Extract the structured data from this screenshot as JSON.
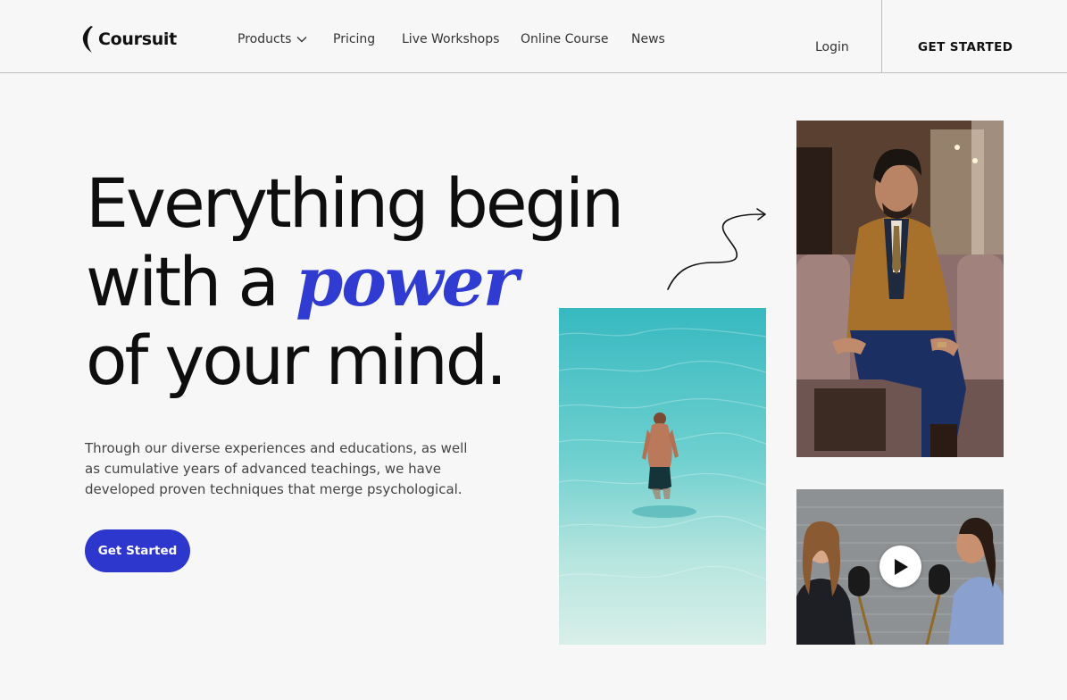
{
  "brand": {
    "name": "Coursuit",
    "icon": "crescent-logo-icon"
  },
  "nav": {
    "items": [
      {
        "label": "Products",
        "has_dropdown": true
      },
      {
        "label": "Pricing"
      },
      {
        "label": "Live Workshops"
      },
      {
        "label": "Online Course"
      },
      {
        "label": "News"
      }
    ],
    "login": "Login",
    "cta": "GET STARTED"
  },
  "hero": {
    "headline_line1": "Everything begin",
    "headline_line2_prefix": "with a ",
    "headline_accent": "power",
    "headline_line3": "of your mind.",
    "subtitle": "Through our diverse experiences and educations, as well as cumulative years of advanced teachings, we have developed proven techniques that merge psychological.",
    "cta": "Get Started"
  },
  "media": {
    "photo_sea": "man-walking-into-sea-photo",
    "photo_man": "man-in-suit-seated-photo",
    "video": "podcast-conversation-video",
    "play_icon": "play-icon"
  },
  "colors": {
    "accent": "#2f3bd1",
    "button": "#2d37cd",
    "background": "#f7f7f7",
    "text": "#111111"
  }
}
